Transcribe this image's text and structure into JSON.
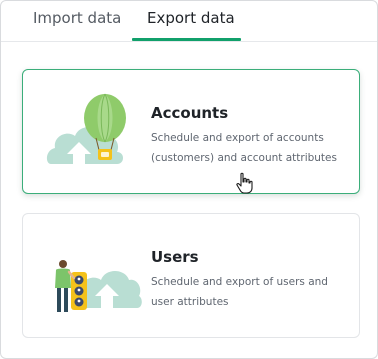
{
  "tabs": {
    "import_label": "Import data",
    "export_label": "Export data",
    "active": "Export data"
  },
  "cards": {
    "accounts": {
      "title": "Accounts",
      "description": "Schedule and export of accounts (customers) and account attributes"
    },
    "users": {
      "title": "Users",
      "description": "Schedule and export of users and user attributes"
    }
  },
  "colors": {
    "accent": "#11a06b",
    "card_selected_border": "#3bae7a",
    "illustration_cloud": "#b9ded3",
    "balloon": "#8fcb6a",
    "token_yellow": "#f4c21a"
  },
  "icons": {
    "accounts": "hot-air-balloon-cloud-upload-icon",
    "users": "person-cloud-upload-icon",
    "cursor": "hand-pointer-cursor-icon"
  }
}
